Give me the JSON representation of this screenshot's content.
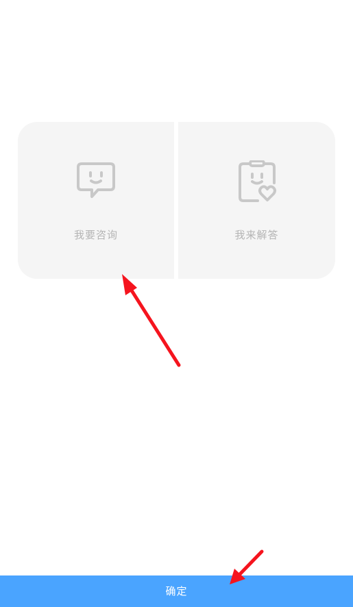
{
  "options": [
    {
      "label": "我要咨询",
      "icon": "chat-bubble-smile-icon"
    },
    {
      "label": "我来解答",
      "icon": "clipboard-heart-icon"
    }
  ],
  "confirm_label": "确定",
  "colors": {
    "card_bg": "#f5f5f5",
    "icon_gray": "#c8c8c8",
    "label_gray": "#b4b4b4",
    "confirm_bg": "#4aa4ff",
    "annotation_red": "#f5141e"
  }
}
